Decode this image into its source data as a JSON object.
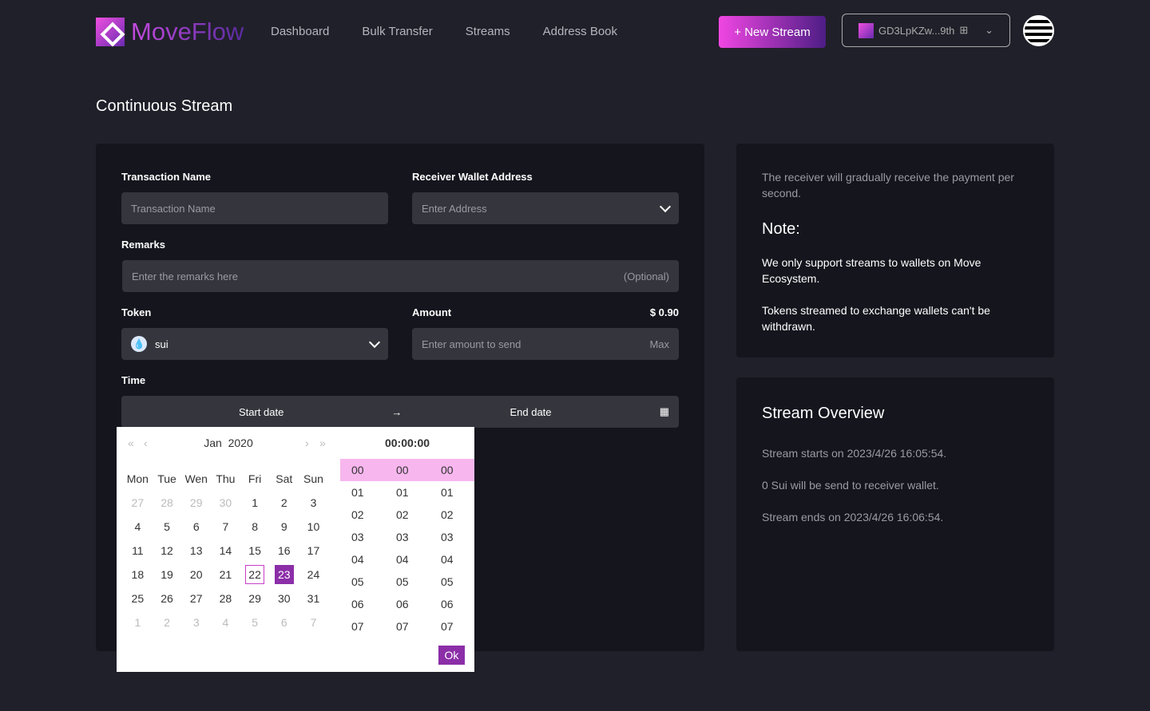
{
  "brand": "MoveFlow",
  "nav": [
    "Dashboard",
    "Bulk Transfer",
    "Streams",
    "Address Book"
  ],
  "new_stream": "+ New Stream",
  "wallet": "GD3LpKZw...9th",
  "title": "Continuous Stream",
  "form": {
    "tx_label": "Transaction Name",
    "tx_placeholder": "Transaction Name",
    "recv_label": "Receiver Wallet Address",
    "recv_placeholder": "Enter Address",
    "remarks_label": "Remarks",
    "remarks_placeholder": "Enter the remarks here",
    "remarks_optional": "(Optional)",
    "token_label": "Token",
    "token_value": "sui",
    "amount_label": "Amount",
    "amount_usd": "$ 0.90",
    "amount_placeholder": "Enter amount to send",
    "max": "Max",
    "time_label": "Time",
    "start": "Start date",
    "arrow": "→",
    "end": "End date"
  },
  "calendar": {
    "month": "Jan",
    "year": "2020",
    "weekdays": [
      "Mon",
      "Tue",
      "Wen",
      "Thu",
      "Fri",
      "Sat",
      "Sun"
    ],
    "days": [
      "27",
      "28",
      "29",
      "30",
      "1",
      "2",
      "3",
      "4",
      "5",
      "6",
      "7",
      "8",
      "9",
      "10",
      "11",
      "12",
      "13",
      "14",
      "15",
      "16",
      "17",
      "18",
      "19",
      "20",
      "21",
      "22",
      "23",
      "24",
      "25",
      "26",
      "27",
      "28",
      "29",
      "30",
      "31",
      "1",
      "2",
      "3",
      "4",
      "5",
      "6",
      "7"
    ],
    "time": "00:00:00",
    "times": [
      "00",
      "01",
      "02",
      "03",
      "04",
      "05",
      "06",
      "07"
    ],
    "ok": "Ok"
  },
  "info": {
    "intro": "The receiver will gradually receive the payment per second.",
    "note_title": "Note:",
    "note1": "We only support streams to wallets on Move Ecosystem.",
    "note2": "Tokens streamed to exchange wallets can't be withdrawn."
  },
  "overview": {
    "title": "Stream Overview",
    "l1": "Stream starts on 2023/4/26 16:05:54.",
    "l2": "0 Sui will be send to receiver wallet.",
    "l3": "Stream ends on 2023/4/26 16:06:54."
  }
}
